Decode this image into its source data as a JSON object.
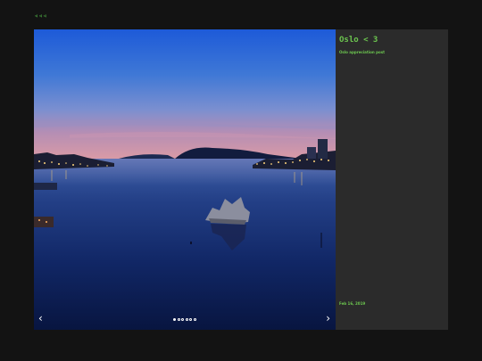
{
  "nav": {
    "back_label": "◃◃◃"
  },
  "post": {
    "title": "Oslo < 3",
    "caption": "Oslo appreciation post",
    "date": "Feb 16, 2019"
  },
  "gallery": {
    "prev_label": "‹",
    "next_label": "›",
    "slide_count": 6,
    "active_slide": 1,
    "image_subject": "Oslo fjord at dusk with city lights and a sculpture in the water"
  },
  "colors": {
    "page_bg": "#131313",
    "side_bg": "#2b2b2b",
    "accent": "#6cc64f"
  }
}
